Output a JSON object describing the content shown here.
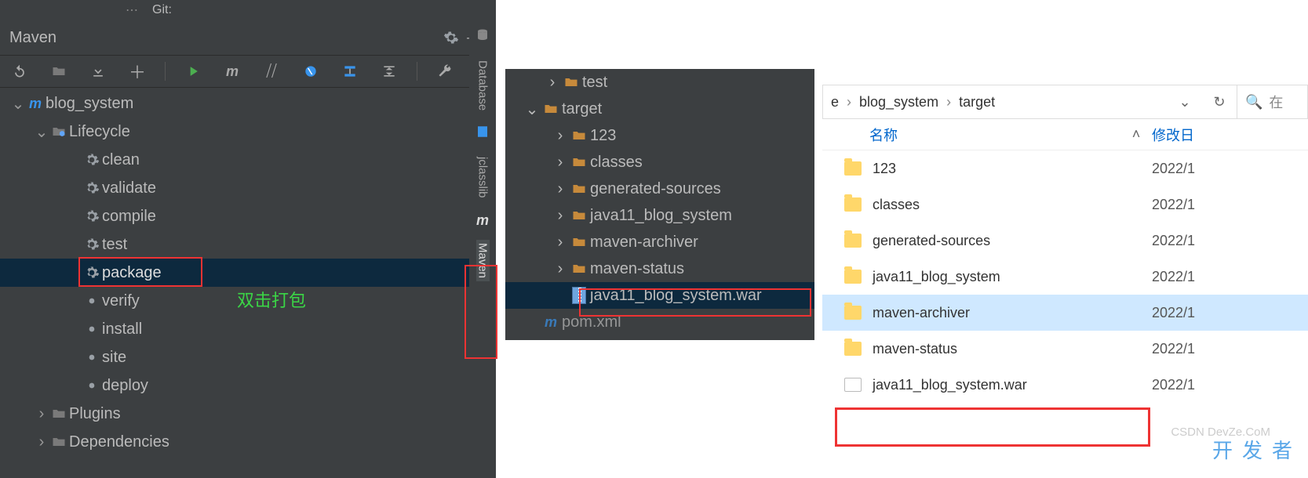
{
  "ij": {
    "git_label": "Git:",
    "panel_title": "Maven",
    "rightrail": {
      "database": "Database",
      "jclasslib": "jclasslib",
      "maven": "Maven"
    },
    "tree": {
      "root": "blog_system",
      "lifecycle_label": "Lifecycle",
      "phases": [
        "clean",
        "validate",
        "compile",
        "test",
        "package",
        "verify",
        "install",
        "site",
        "deploy"
      ],
      "plugins_label": "Plugins",
      "deps_label": "Dependencies"
    },
    "annotation": "双击打包"
  },
  "mid": {
    "items": {
      "test": "test",
      "target": "target",
      "children": [
        "123",
        "classes",
        "generated-sources",
        "java11_blog_system",
        "maven-archiver",
        "maven-status"
      ],
      "war": "java11_blog_system.war",
      "pom": "pom.xml"
    }
  },
  "win": {
    "breadcrumb": {
      "seg0": "e",
      "seg1": "blog_system",
      "seg2": "target"
    },
    "search_placeholder": "在",
    "columns": {
      "name": "名称",
      "mdate": "修改日"
    },
    "rows": [
      {
        "name": "123",
        "type": "folder",
        "date": "2022/1"
      },
      {
        "name": "classes",
        "type": "folder",
        "date": "2022/1"
      },
      {
        "name": "generated-sources",
        "type": "folder",
        "date": "2022/1"
      },
      {
        "name": "java11_blog_system",
        "type": "folder",
        "date": "2022/1"
      },
      {
        "name": "maven-archiver",
        "type": "folder",
        "date": "2022/1",
        "selected": true
      },
      {
        "name": "maven-status",
        "type": "folder",
        "date": "2022/1"
      },
      {
        "name": "java11_blog_system.war",
        "type": "file",
        "date": "2022/1"
      }
    ],
    "watermark": "开发者",
    "csdn": "CSDN DevZe.CoM"
  }
}
